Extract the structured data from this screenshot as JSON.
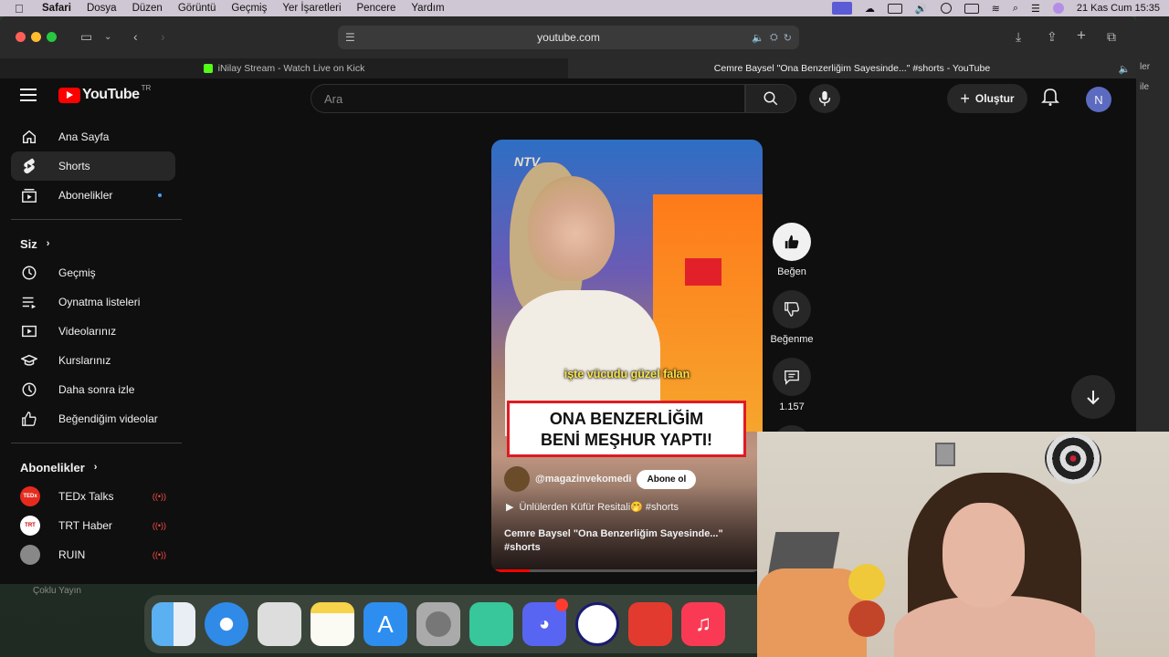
{
  "menubar": {
    "app_name": "Safari",
    "items": [
      "Dosya",
      "Düzen",
      "Görüntü",
      "Geçmiş",
      "Yer İşaretleri",
      "Pencere",
      "Yardım"
    ],
    "datetime": "21 Kas Cum  15:35"
  },
  "browser": {
    "url": "youtube.com",
    "tabs": [
      {
        "title": "iNilay Stream - Watch Live on Kick",
        "active": false
      },
      {
        "title": "Cemre Baysel \"Ona Benzerliğim Sayesinde...\" #shorts - YouTube",
        "active": true
      }
    ],
    "edge_text_1": "ler",
    "edge_text_2": "ile"
  },
  "youtube": {
    "logo_text": "YouTube",
    "region": "TR",
    "search_placeholder": "Ara",
    "create_label": "Oluştur",
    "avatar_letter": "N",
    "sidebar_main": [
      {
        "label": "Ana Sayfa",
        "icon": "home-icon"
      },
      {
        "label": "Shorts",
        "icon": "shorts-icon",
        "active": true
      },
      {
        "label": "Abonelikler",
        "icon": "subscriptions-icon",
        "dot": true
      }
    ],
    "you_section": {
      "title": "Siz",
      "items": [
        {
          "label": "Geçmiş",
          "icon": "history-icon"
        },
        {
          "label": "Oynatma listeleri",
          "icon": "playlists-icon"
        },
        {
          "label": "Videolarınız",
          "icon": "your-videos-icon"
        },
        {
          "label": "Kurslarınız",
          "icon": "courses-icon"
        },
        {
          "label": "Daha sonra izle",
          "icon": "watch-later-icon"
        },
        {
          "label": "Beğendiğim videolar",
          "icon": "liked-icon"
        }
      ]
    },
    "subscriptions": {
      "title": "Abonelikler",
      "channels": [
        {
          "name": "TEDx Talks",
          "color": "#e62b1e",
          "avatar_text": "TEDx"
        },
        {
          "name": "TRT Haber",
          "color": "#ffffff",
          "avatar_text": "TRT"
        },
        {
          "name": "RUIN",
          "color": "#888888",
          "avatar_text": ""
        }
      ]
    },
    "short": {
      "watermark": "NTV",
      "caption": "işte vücudu güzel falan",
      "title_card_line1": "ONA BENZERLİĞİM",
      "title_card_line2": "BENİ MEŞHUR YAPTI!",
      "channel_handle": "@magazinvekomedi",
      "subscribe_label": "Abone ol",
      "description": "Ünlülerden Küfür Resitali🤭 #shorts",
      "title": "Cemre Baysel \"Ona Benzerliğim Sayesinde...\"",
      "hashtag": "#shorts",
      "progress": 0.14
    },
    "actions": {
      "like_label": "Beğen",
      "dislike_label": "Beğenme",
      "comments_count": "1.157"
    }
  },
  "dock_label": "Çoklu Yayın",
  "colors": {
    "yt_red": "#ff0000",
    "accent_blue": "#3ea6ff",
    "live_red": "#ff4e45"
  }
}
